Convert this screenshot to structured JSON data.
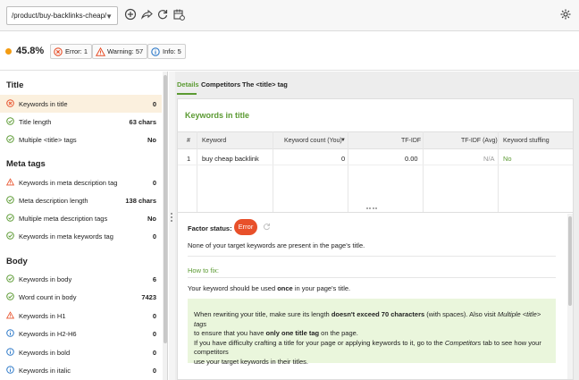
{
  "toolbar": {
    "url_value": "/product/buy-backlinks-cheap/",
    "icons": [
      "add-icon",
      "share-icon",
      "refresh-icon",
      "calendar-icon",
      "gear-icon"
    ]
  },
  "status": {
    "score": "45.8%",
    "error_label": "Error: 1",
    "warning_label": "Warning: 57",
    "info_label": "Info: 5",
    "colors": {
      "error": "#e8502a",
      "warning": "#e8502a",
      "info": "#2b78c8",
      "ok": "#5b9a32",
      "score_dot": "#f39c12"
    }
  },
  "sidebar": {
    "sections": [
      {
        "title": "Title",
        "items": [
          {
            "label": "Keywords in title",
            "value": "0",
            "status": "error"
          },
          {
            "label": "Title length",
            "value": "63 chars",
            "status": "ok"
          },
          {
            "label": "Multiple <title> tags",
            "value": "No",
            "status": "ok"
          }
        ]
      },
      {
        "title": "Meta tags",
        "items": [
          {
            "label": "Keywords in meta description tag",
            "value": "0",
            "status": "warning"
          },
          {
            "label": "Meta description length",
            "value": "138 chars",
            "status": "ok"
          },
          {
            "label": "Multiple meta description tags",
            "value": "No",
            "status": "ok"
          },
          {
            "label": "Keywords in meta keywords tag",
            "value": "0",
            "status": "ok"
          }
        ]
      },
      {
        "title": "Body",
        "items": [
          {
            "label": "Keywords in body",
            "value": "6",
            "status": "ok"
          },
          {
            "label": "Word count in body",
            "value": "7423",
            "status": "ok"
          },
          {
            "label": "Keywords in H1",
            "value": "0",
            "status": "warning"
          },
          {
            "label": "Keywords in H2-H6",
            "value": "0",
            "status": "info"
          },
          {
            "label": "Keywords in bold",
            "value": "0",
            "status": "info"
          },
          {
            "label": "Keywords in italic",
            "value": "0",
            "status": "info"
          }
        ]
      }
    ]
  },
  "tabs": [
    "Details",
    "Competitors",
    "The <title> tag"
  ],
  "details": {
    "title": "Keywords in title",
    "columns": [
      "#",
      "Keyword",
      "Keyword count (You)",
      "TF-IDF",
      "TF-IDF (Avg)",
      "Keyword stuffing"
    ],
    "rows": [
      {
        "num": "1",
        "keyword": "buy cheap backlink",
        "count": "0",
        "tfidf": "0.00",
        "tfidf_avg": "N/A",
        "stuffing": "No"
      }
    ]
  },
  "factor": {
    "label": "Factor status:",
    "badge": "Error",
    "message": "None of your target keywords are present in the page's title.",
    "howto_label": "How to fix:",
    "howto_pre": "Your keyword should be used ",
    "howto_bold": "once",
    "howto_post": " in your page's title.",
    "tip": {
      "l1a": "When rewriting your title, make sure its length ",
      "l1b": "doesn't exceed 70 characters",
      "l1c": " (with spaces). Also visit ",
      "l1d": "Multiple <title> tags",
      "l2a": "to ensure that you have ",
      "l2b": "only one title tag",
      "l2c": " on the page.",
      "l3": "If you have difficulty crafting a title for your page or applying keywords to it, go to the ",
      "l3b": "Competitors",
      "l3c": " tab to see how your competitors",
      "l4": "use your target keywords in their titles."
    }
  }
}
